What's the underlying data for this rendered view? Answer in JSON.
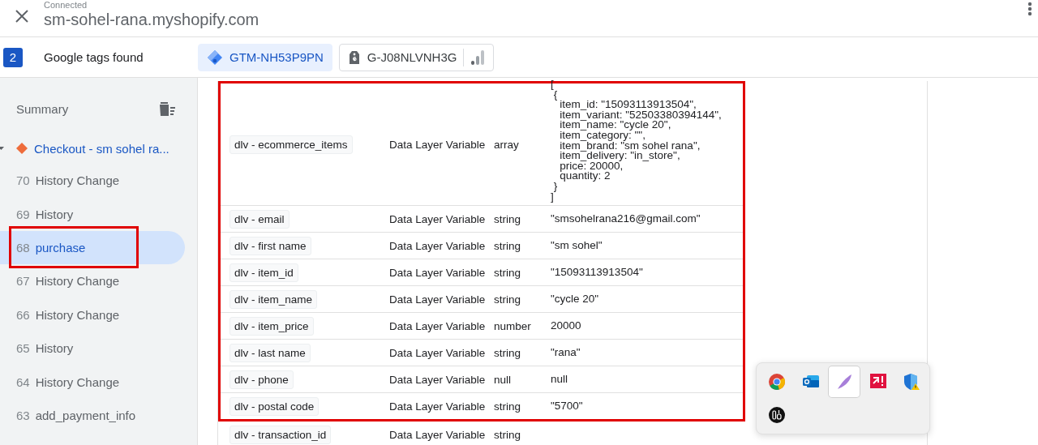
{
  "header": {
    "status": "Connected",
    "title": "sm-sohel-rana.myshopify.com"
  },
  "tag_bar": {
    "count": "2",
    "label": "Google tags found",
    "tags": [
      {
        "kind": "gtm",
        "label": "GTM-NH53P9PN",
        "selected": true
      },
      {
        "kind": "ga",
        "label": "G-J08NLVNH3G",
        "selected": false
      }
    ]
  },
  "sidebar": {
    "title": "Summary",
    "groups": [
      {
        "label": "Checkout - sm sohel ra...",
        "expanded": true,
        "items": [
          {
            "number": "70",
            "label": "History Change",
            "selected": false,
            "highlighted": false
          },
          {
            "number": "69",
            "label": "History",
            "selected": false,
            "highlighted": false
          },
          {
            "number": "68",
            "label": "purchase",
            "selected": true,
            "highlighted": true
          },
          {
            "number": "67",
            "label": "History Change",
            "selected": false,
            "highlighted": false
          },
          {
            "number": "66",
            "label": "History Change",
            "selected": false,
            "highlighted": false
          },
          {
            "number": "65",
            "label": "History",
            "selected": false,
            "highlighted": false
          },
          {
            "number": "64",
            "label": "History Change",
            "selected": false,
            "highlighted": false
          },
          {
            "number": "63",
            "label": "add_payment_info",
            "selected": false,
            "highlighted": false
          }
        ]
      }
    ]
  },
  "table": {
    "highlighted_rows": [
      {
        "name": "dlv - ecommerce_items",
        "type": "Data Layer Variable",
        "data_type": "array",
        "value": "[\n {\n   item_id: \"15093113913504\",\n   item_variant: \"52503380394144\",\n   item_name: \"cycle 20\",\n   item_category: \"\",\n   item_brand: \"sm sohel rana\",\n   item_delivery: \"in_store\",\n   price: 20000,\n   quantity: 2\n }\n]"
      },
      {
        "name": "dlv - email",
        "type": "Data Layer Variable",
        "data_type": "string",
        "value": "\"smsohelrana216@gmail.com\""
      },
      {
        "name": "dlv - first name",
        "type": "Data Layer Variable",
        "data_type": "string",
        "value": "\"sm sohel\""
      },
      {
        "name": "dlv - item_id",
        "type": "Data Layer Variable",
        "data_type": "string",
        "value": "\"15093113913504\""
      },
      {
        "name": "dlv - item_name",
        "type": "Data Layer Variable",
        "data_type": "string",
        "value": "\"cycle 20\""
      },
      {
        "name": "dlv - item_price",
        "type": "Data Layer Variable",
        "data_type": "number",
        "value": "20000"
      },
      {
        "name": "dlv - last name",
        "type": "Data Layer Variable",
        "data_type": "string",
        "value": "\"rana\""
      },
      {
        "name": "dlv - phone",
        "type": "Data Layer Variable",
        "data_type": "null",
        "value": "null"
      },
      {
        "name": "dlv - postal code",
        "type": "Data Layer Variable",
        "data_type": "string",
        "value": "\"5700\""
      }
    ],
    "rows": [
      {
        "name": "dlv - transaction_id",
        "type": "Data Layer Variable",
        "data_type": "string"
      }
    ]
  },
  "tray": {
    "icons": [
      {
        "kind": "chrome",
        "selected": false
      },
      {
        "kind": "outlook",
        "selected": false
      },
      {
        "kind": "feather",
        "selected": true
      },
      {
        "kind": "red-app",
        "selected": false
      },
      {
        "kind": "shield",
        "selected": false
      },
      {
        "kind": "black-app",
        "selected": false
      }
    ]
  }
}
